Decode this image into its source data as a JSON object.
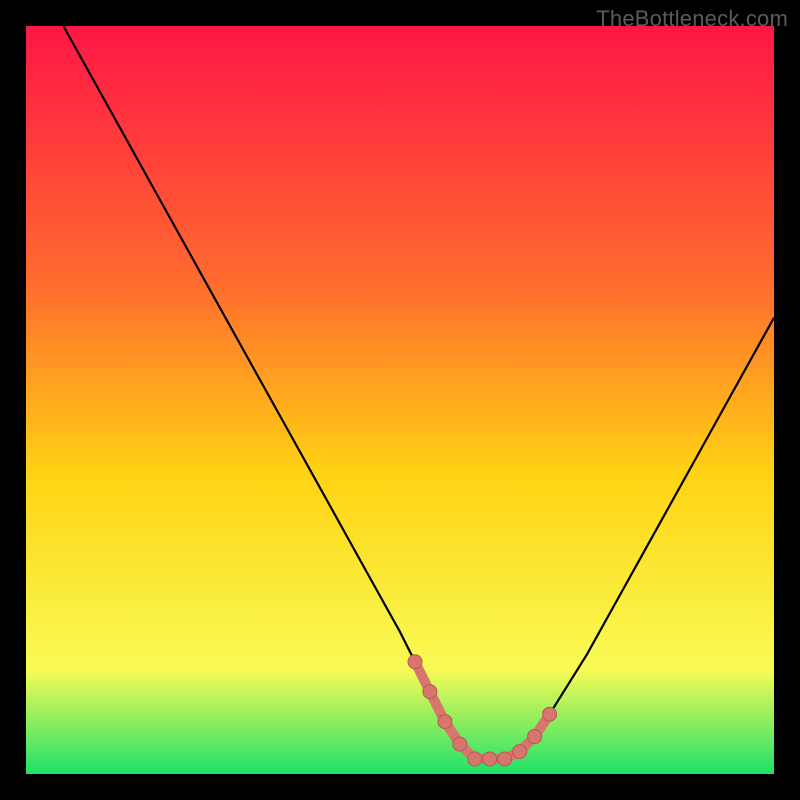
{
  "watermark": "TheBottleneck.com",
  "colors": {
    "background": "#000000",
    "gradient_top": "#ff1646",
    "gradient_upper_mid": "#ff6a2e",
    "gradient_mid": "#ffd313",
    "gradient_lower_mid": "#f8fb55",
    "gradient_bottom": "#1fe06a",
    "curve": "#000000",
    "marker_fill": "#d8766d",
    "marker_stroke": "#b45a53"
  },
  "chart_data": {
    "type": "line",
    "title": "",
    "xlabel": "",
    "ylabel": "",
    "xlim": [
      0,
      100
    ],
    "ylim": [
      0,
      100
    ],
    "series": [
      {
        "name": "curve",
        "x": [
          5,
          10,
          15,
          20,
          25,
          30,
          35,
          40,
          45,
          50,
          52,
          54,
          56,
          58,
          60,
          62,
          64,
          66,
          68,
          70,
          75,
          80,
          85,
          90,
          95,
          100
        ],
        "values": [
          100,
          91,
          82,
          73,
          64,
          55,
          46,
          37,
          28,
          19,
          15,
          11,
          7,
          4,
          2,
          2,
          2,
          3,
          5,
          8,
          16,
          25,
          34,
          43,
          52,
          61
        ]
      }
    ],
    "markers": {
      "name": "bottom-highlight",
      "x": [
        52,
        54,
        56,
        58,
        60,
        62,
        64,
        66,
        68,
        70
      ],
      "values": [
        15,
        11,
        7,
        4,
        2,
        2,
        2,
        3,
        5,
        8
      ]
    }
  }
}
